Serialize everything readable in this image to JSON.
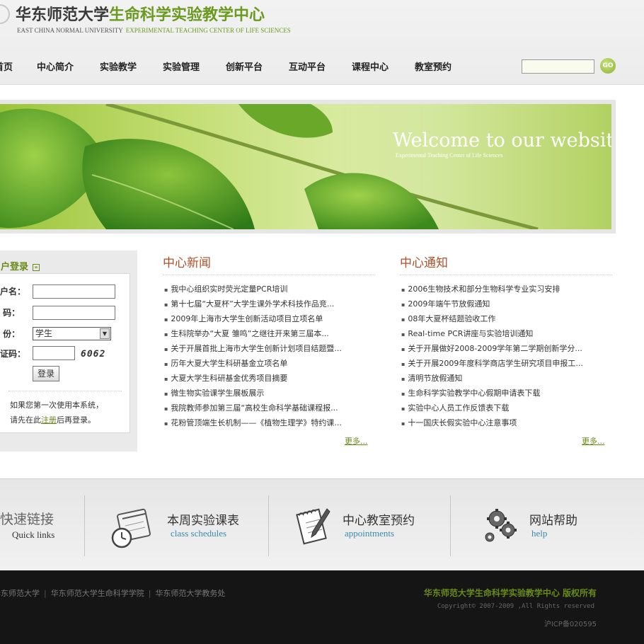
{
  "header": {
    "title_part1": "华东师范大学",
    "title_part2": "生命科学实验教学中心",
    "subtitle_part1": "EAST CHINA NORMAL UNIVERSITY",
    "subtitle_part2": "EXPERIMENTAL TEACHING CENTER OF LIFE SCIENCES"
  },
  "nav": {
    "items": [
      "首页",
      "中心简介",
      "实验教学",
      "实验管理",
      "创新平台",
      "互动平台",
      "课程中心",
      "教室预约"
    ]
  },
  "search": {
    "value": "",
    "go_label": "GO"
  },
  "banner": {
    "welcome": "Welcome to our website",
    "sub": "Experimental Teaching Center of Life Sciences"
  },
  "login": {
    "heading": "用户登录",
    "username_label": "用户名：",
    "password_label": "密  码：",
    "identity_label": "身  份：",
    "identity_value": "学生",
    "captcha_label": "验证码：",
    "captcha_text": "6062",
    "button": "登录",
    "tip_line1": "如果您第一次使用本系统，",
    "tip_line2_a": "请先在此",
    "tip_line2_link": "注册",
    "tip_line2_b": "后再登录。"
  },
  "news": {
    "title": "中心新闻",
    "more": "更多...",
    "items": [
      "我中心组织实时荧光定量PCR培训",
      "第十七届“大夏杯”大学生课外学术科技作品竞...",
      "2009年上海市大学生创新活动项目立项名单",
      "生科院举办“大夏 雏鸣”之继往开来第三届本...",
      "关于开展首批上海市大学生创新计划项目结题暨...",
      "历年大夏大学生科研基金立项名单",
      "大夏大学生科研基金优秀项目摘要",
      "微生物实验课学生展板展示",
      "我院教师参加第三届“高校生命科学基础课程报...",
      "花粉管顶端生长机制——《植物生理学》特约课..."
    ]
  },
  "notices": {
    "title": "中心通知",
    "more": "更多...",
    "items": [
      "2006生物技术和部分生物科学专业实习安排",
      "2009年端午节放假通知",
      "08年大夏杯结题验收工作",
      "Real-time PCR讲座与实验培训通知",
      "关于开展做好2008-2009学年第二学期创新学分...",
      "关于开展2009年度科学商店学生研究项目申报工...",
      "清明节放假通知",
      "生命科学实验教学中心假期申请表下载",
      "实验中心人员工作反馈表下载",
      "十一国庆长假实验中心注意事项"
    ]
  },
  "quick": {
    "title": "快速链接",
    "sub": "Quick links",
    "links": [
      {
        "title": "本周实验课表",
        "sub": "class schedules",
        "icon": "calendar-clock-icon"
      },
      {
        "title": "中心教室预约",
        "sub": "appointments",
        "icon": "notepad-pen-icon"
      },
      {
        "title": "网站帮助",
        "sub": "help",
        "icon": "gears-icon"
      }
    ]
  },
  "footer": {
    "links": [
      "华东师范大学",
      "华东师范大学生命科学学院",
      "华东师范大学教务处"
    ],
    "copyright_org": "华东师范大学生命科学实验教学中心 版权所有",
    "copyright_line": "Copyright© 2007-2009 ,All Rights reserved",
    "icp": "沪ICP备020595"
  },
  "colors": {
    "accent_green": "#6a9a1f",
    "section_title": "#b0502a",
    "link_blue": "#3a8ab0",
    "footer_bg": "#151515"
  }
}
